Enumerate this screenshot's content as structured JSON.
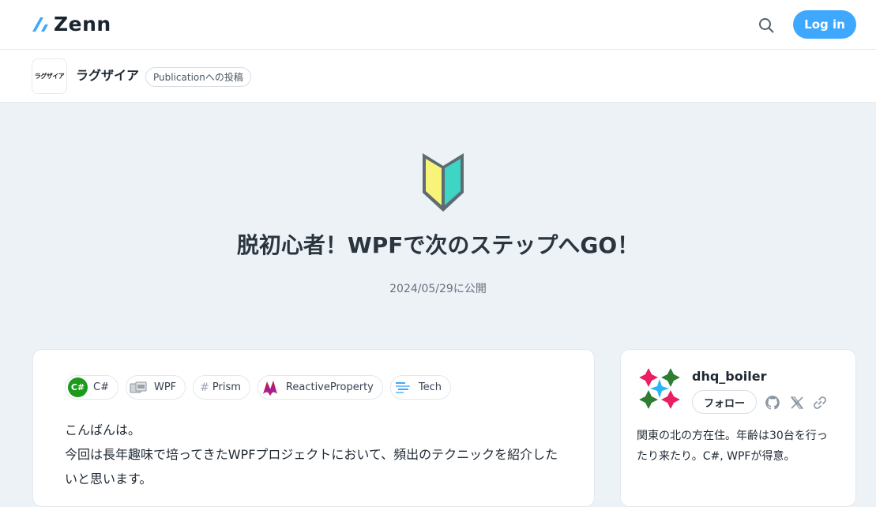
{
  "header": {
    "logo_text": "Zenn",
    "login_label": "Log in"
  },
  "publication": {
    "avatar_text": "ラグザイア",
    "name": "ラグザイア",
    "badge": "Publicationへの投稿"
  },
  "article": {
    "emoji": "beginner-mark-icon",
    "title": "脱初心者！WPFで次のステップへGO！",
    "published": "2024/05/29に公開",
    "tags": [
      {
        "label": "C#",
        "icon": "csharp-icon"
      },
      {
        "label": "WPF",
        "icon": "wpf-icon"
      },
      {
        "label": "Prism",
        "icon": "hash-icon",
        "glyph": "#"
      },
      {
        "label": "ReactiveProperty",
        "icon": "reactiveproperty-icon"
      },
      {
        "label": "Tech",
        "icon": "tech-icon"
      }
    ],
    "csharp_glyph": "C#",
    "lines": [
      "こんばんは。",
      "今回は長年趣味で培ってきたWPFプロジェクトにおいて、頻出のテクニックを紹介した",
      "いと思います。"
    ]
  },
  "author": {
    "name": "dhq_boiler",
    "follow_label": "フォロー",
    "bio_lines": [
      "関東の北の方在住。年齢は30台を行っ",
      "たり来たり。C#, WPFが得意。"
    ]
  },
  "colors": {
    "accent": "#3ea8ff",
    "background": "#edf2f7",
    "beginner_yellow": "#f8f47a",
    "beginner_teal": "#3fd5c4"
  }
}
